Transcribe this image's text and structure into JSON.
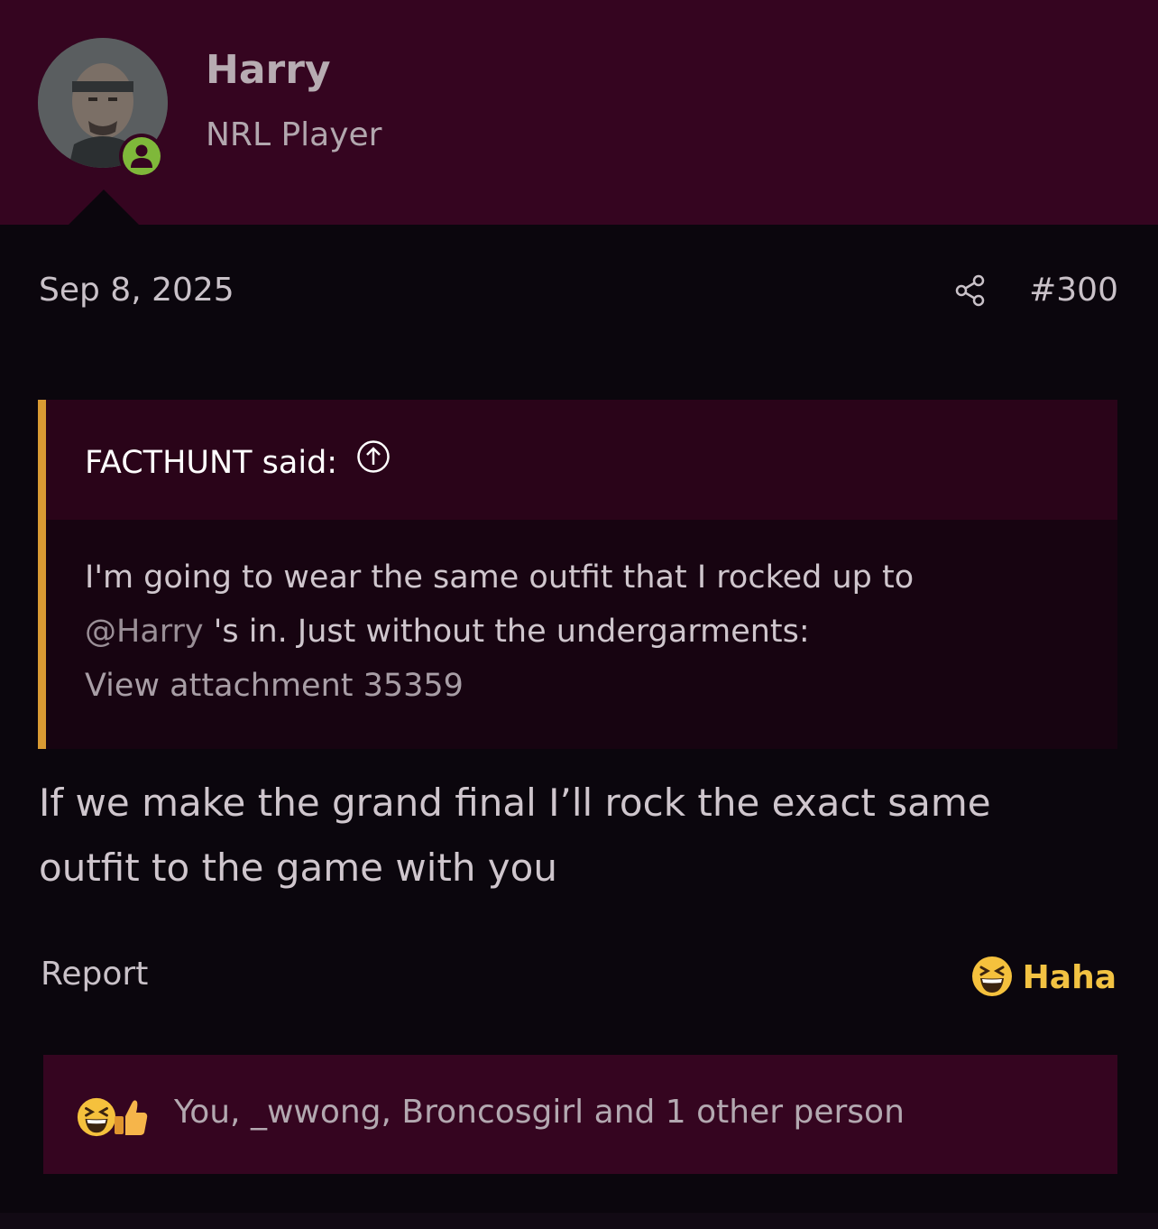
{
  "author": {
    "name": "Harry",
    "title": "NRL Player",
    "status_icon": "user-online-icon",
    "colors": {
      "status": "#7fb83a"
    }
  },
  "post": {
    "date": "Sep 8, 2025",
    "number": "#300",
    "share_icon": "share-icon"
  },
  "quote": {
    "author_label": "FACTHUNT said:",
    "jump_icon": "arrow-up-circle-icon",
    "line1": "I'm going to wear the same outfit that I rocked up to",
    "mention": "@Harry",
    "line2_rest": " 's in. Just without the undergarments:",
    "attachment": "View attachment 35359",
    "colors": {
      "border": "#d99a33"
    }
  },
  "message": {
    "line1": "If we make the grand final I’ll rock the exact same",
    "line2": "outfit to the game with you"
  },
  "actions": {
    "report": "Report",
    "reaction_label": "Haha",
    "reaction_icon": "laughing-emoji-icon"
  },
  "reactions": {
    "icons": [
      "laughing-emoji-icon",
      "thumbs-up-icon"
    ],
    "summary": "You, _wwong, Broncosgirl and 1 other person"
  },
  "colors": {
    "header_bg": "#350520",
    "page_bg": "#0b060d",
    "accent_yellow": "#f2c242"
  }
}
